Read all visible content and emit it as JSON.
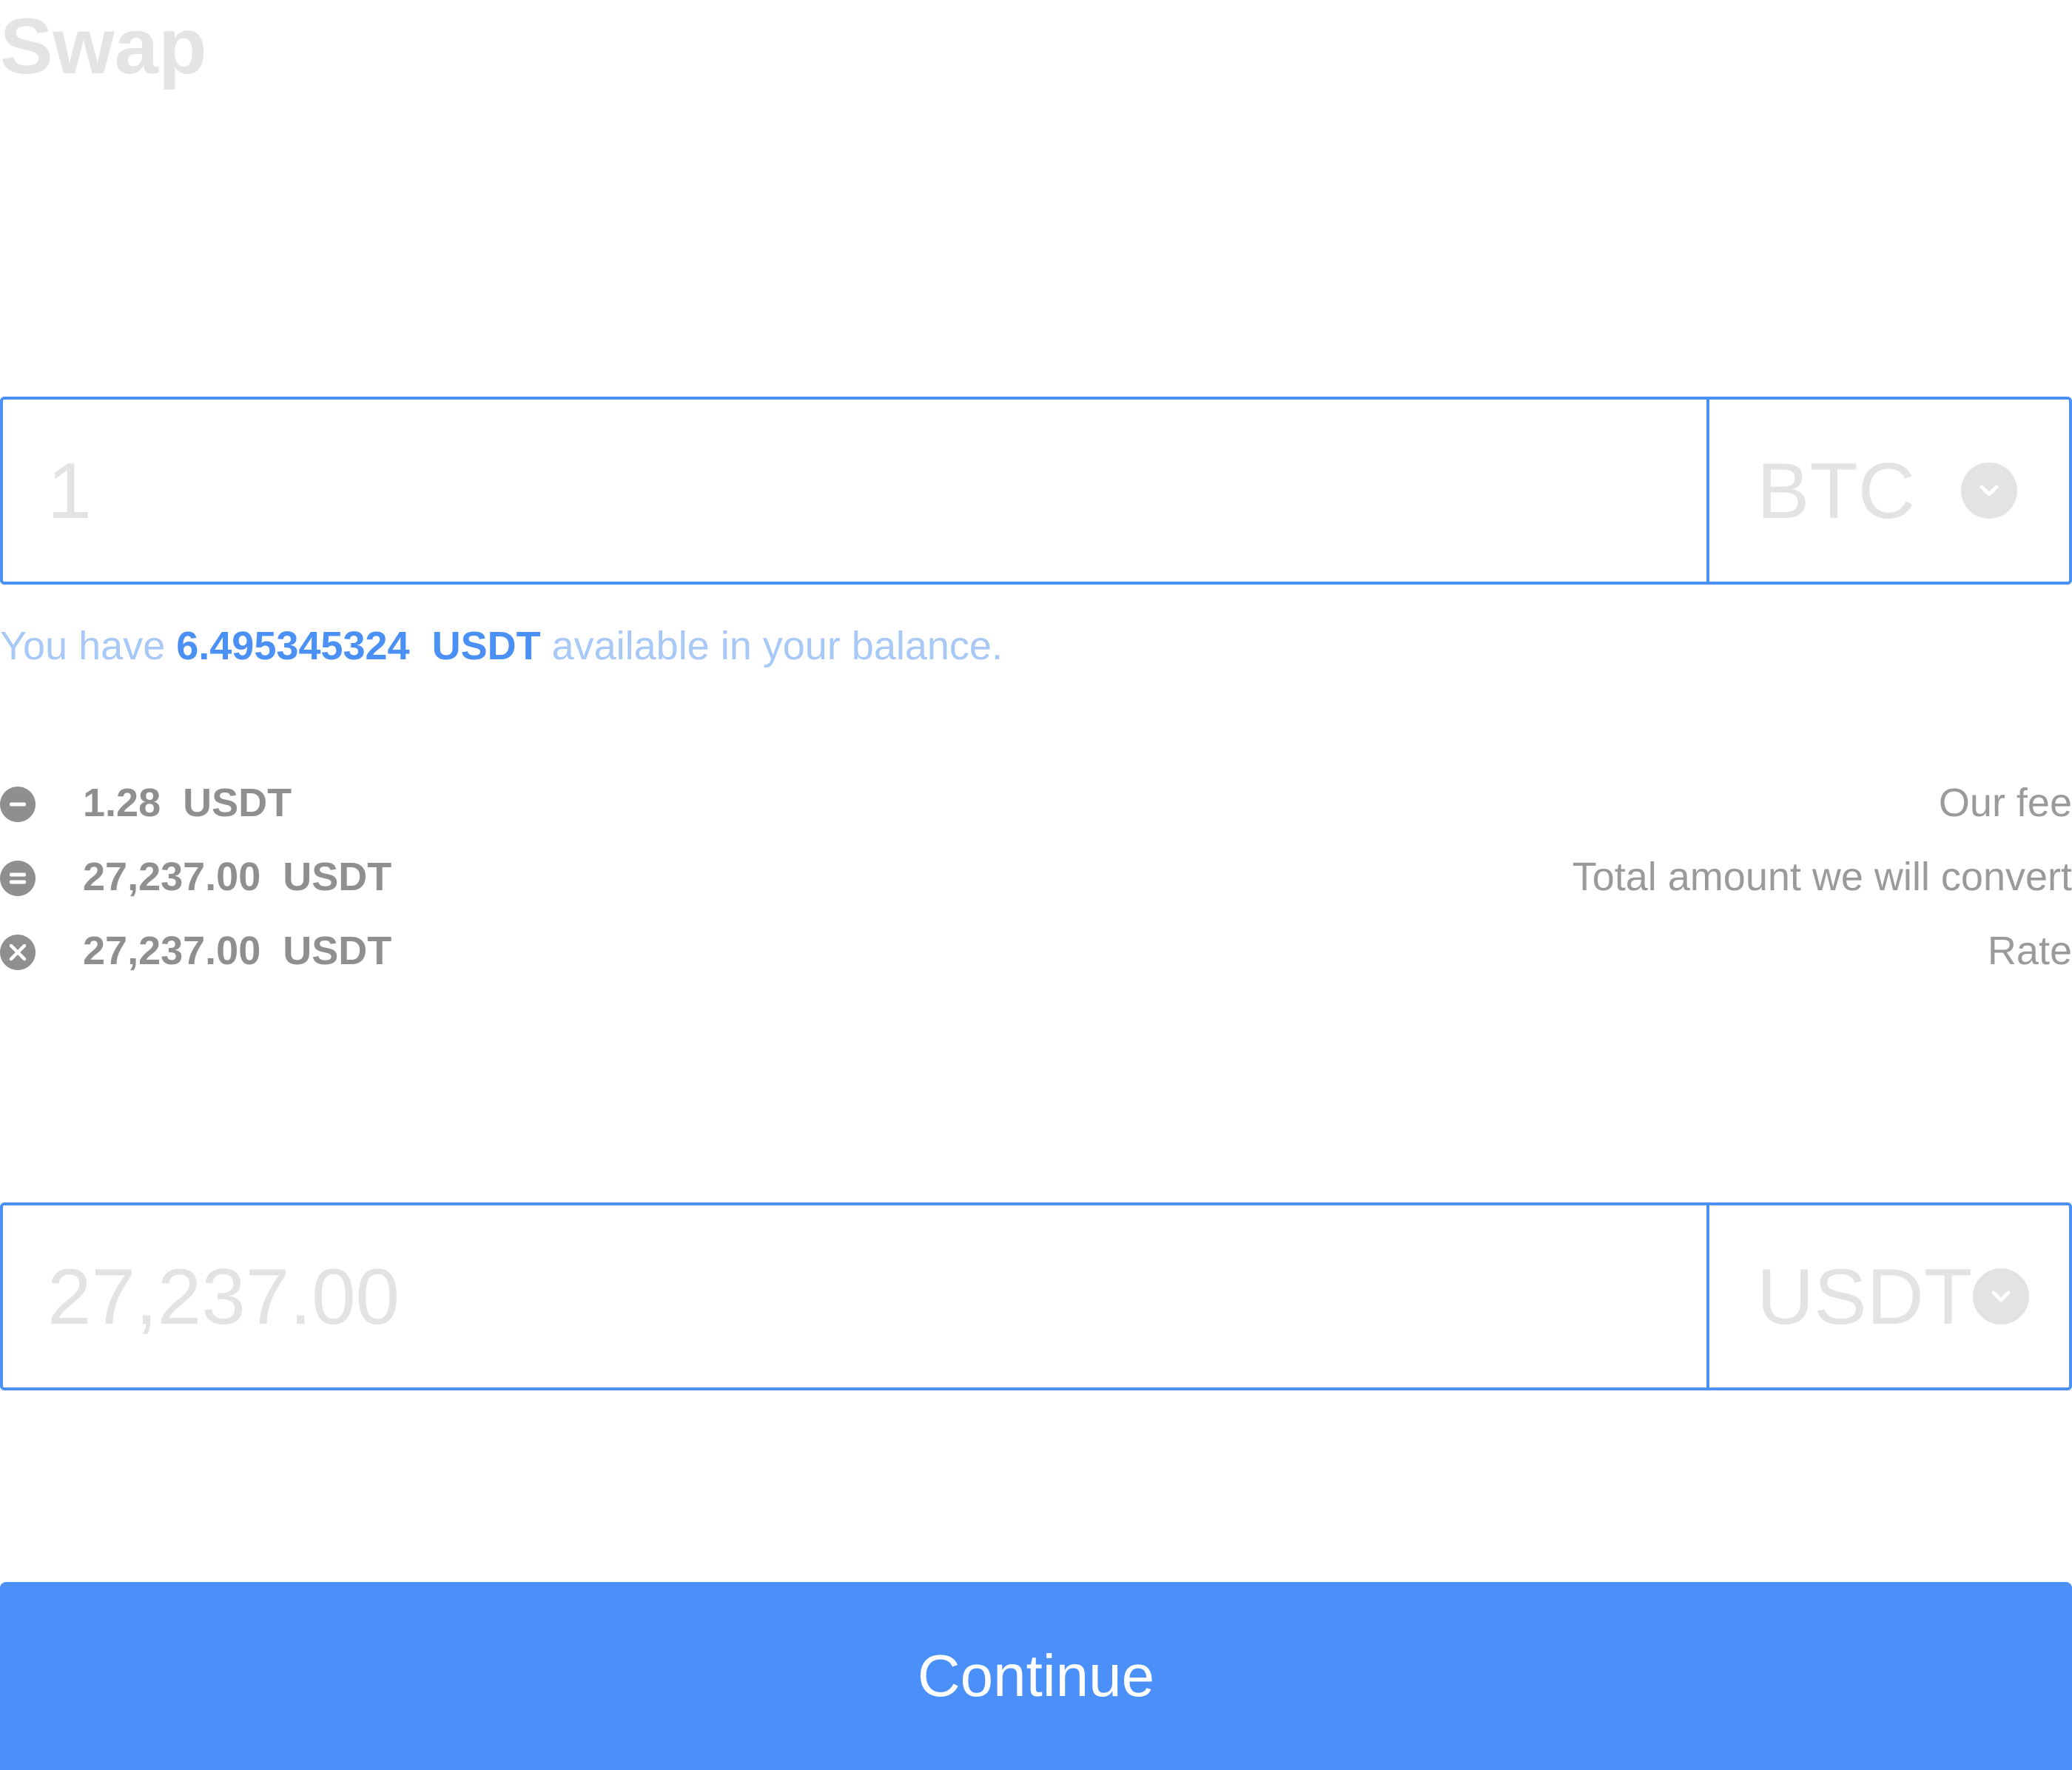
{
  "header": {
    "title": "Swap"
  },
  "from": {
    "amount_value": "1",
    "currency": "BTC"
  },
  "balance": {
    "prefix": "You have ",
    "amount": "6.495345324  USDT",
    "suffix": " available in your balance."
  },
  "summary": {
    "rows": [
      {
        "icon": "minus-circle-icon",
        "value": "1.28  USDT",
        "label": "Our fee"
      },
      {
        "icon": "equals-circle-icon",
        "value": "27,237.00  USDT",
        "label": "Total amount we will convert"
      },
      {
        "icon": "times-circle-icon",
        "value": "27,237.00  USDT",
        "label": "Rate"
      }
    ]
  },
  "to": {
    "amount_value": "27,237.00",
    "currency": "USDT"
  },
  "actions": {
    "continue_label": "Continue"
  },
  "colors": {
    "accent": "#4a90f5",
    "button": "#4a90f8",
    "muted_text": "#8f8f8f",
    "placeholder": "#e3e3e3",
    "balance_text": "#a8c8f8"
  }
}
